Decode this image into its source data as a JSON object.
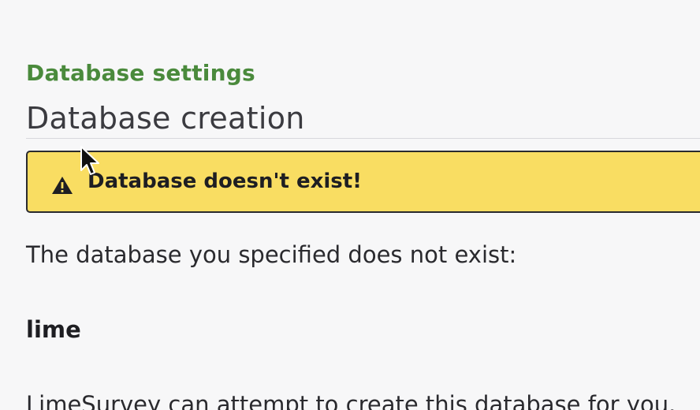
{
  "section": {
    "label": "Database settings"
  },
  "page": {
    "title": "Database creation"
  },
  "alert": {
    "icon": "warning-icon",
    "message": "Database doesn't exist!",
    "background": "#f9dd62"
  },
  "content": {
    "intro": "The database you specified does not exist:",
    "database_name": "lime",
    "followup": "LimeSurvey can attempt to create this database for you."
  },
  "colors": {
    "section_label": "#4a8a3c",
    "alert_bg": "#f9dd62",
    "page_bg": "#f7f7f8"
  }
}
